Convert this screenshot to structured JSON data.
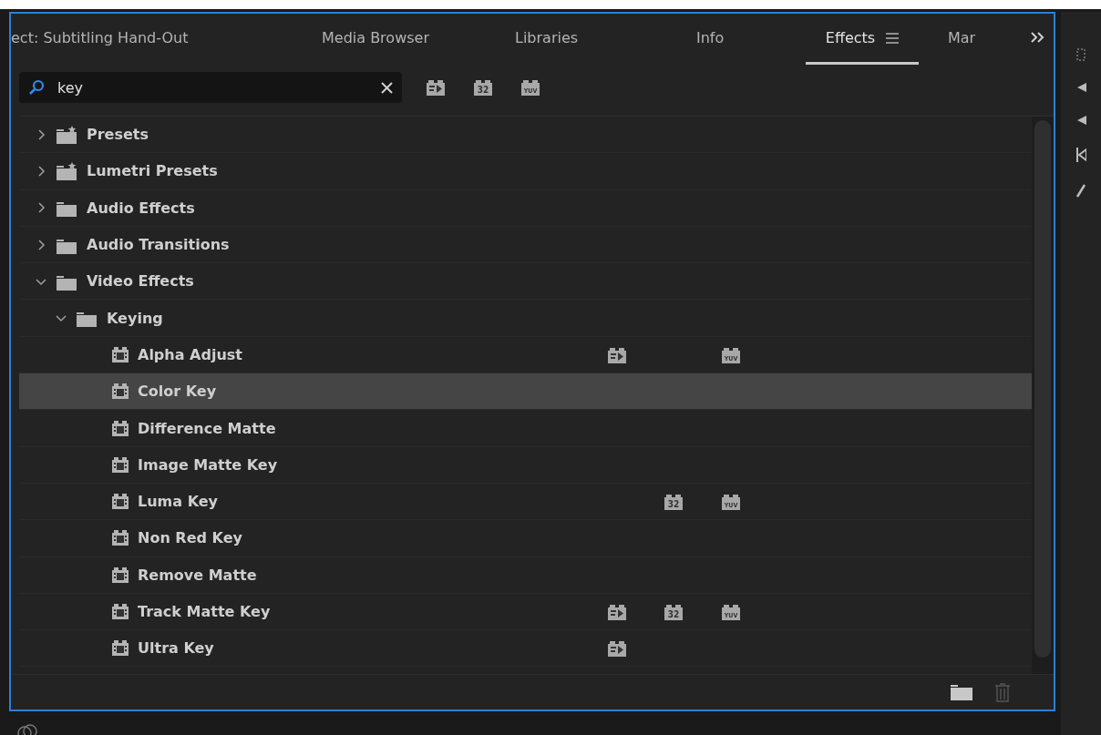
{
  "tabs": [
    {
      "label": "ect: Subtitling Hand-Out",
      "selected": false
    },
    {
      "label": "Media Browser",
      "selected": false
    },
    {
      "label": "Libraries",
      "selected": false
    },
    {
      "label": "Info",
      "selected": false
    },
    {
      "label": "Effects",
      "selected": true
    },
    {
      "label": "Mar",
      "selected": false
    }
  ],
  "search": {
    "value": "key"
  },
  "filter_buttons": [
    {
      "kind": "accelerated"
    },
    {
      "kind": "bit32",
      "label": "32"
    },
    {
      "kind": "yuv",
      "label": "YUV"
    }
  ],
  "tree": [
    {
      "label": "Presets",
      "kind": "preset-folder",
      "expanded": false
    },
    {
      "label": "Lumetri Presets",
      "kind": "preset-folder",
      "expanded": false
    },
    {
      "label": "Audio Effects",
      "kind": "folder",
      "expanded": false
    },
    {
      "label": "Audio Transitions",
      "kind": "folder",
      "expanded": false
    },
    {
      "label": "Video Effects",
      "kind": "folder",
      "expanded": true,
      "children": [
        {
          "label": "Keying",
          "kind": "folder",
          "expanded": true,
          "children": [
            {
              "label": "Alpha Adjust",
              "kind": "effect",
              "selected": false,
              "badges": [
                {
                  "kind": "accelerated"
                },
                {
                  "kind": "yuv",
                  "label": "YUV"
                }
              ]
            },
            {
              "label": "Color Key",
              "kind": "effect",
              "selected": true
            },
            {
              "label": "Difference Matte",
              "kind": "effect",
              "selected": false
            },
            {
              "label": "Image Matte Key",
              "kind": "effect",
              "selected": false
            },
            {
              "label": "Luma Key",
              "kind": "effect",
              "selected": false,
              "badges": [
                {
                  "kind": "bit32",
                  "label": "32"
                },
                {
                  "kind": "yuv",
                  "label": "YUV"
                }
              ]
            },
            {
              "label": "Non Red Key",
              "kind": "effect",
              "selected": false
            },
            {
              "label": "Remove Matte",
              "kind": "effect",
              "selected": false
            },
            {
              "label": "Track Matte Key",
              "kind": "effect",
              "selected": false,
              "badges": [
                {
                  "kind": "accelerated"
                },
                {
                  "kind": "bit32",
                  "label": "32"
                },
                {
                  "kind": "yuv",
                  "label": "YUV"
                }
              ]
            },
            {
              "label": "Ultra Key",
              "kind": "effect",
              "selected": false,
              "badges": [
                {
                  "kind": "accelerated"
                }
              ]
            }
          ]
        }
      ]
    }
  ]
}
